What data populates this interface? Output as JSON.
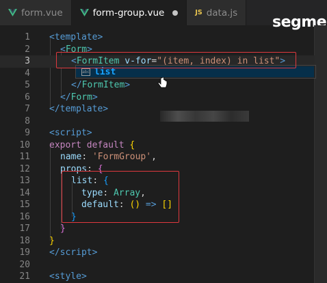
{
  "tabs": [
    {
      "label": "form.vue",
      "icon": "vue-icon"
    },
    {
      "label": "form-group.vue",
      "icon": "vue-icon",
      "active": true,
      "dirty": true
    },
    {
      "label": "data.js",
      "icon": "js-icon",
      "icon_text": "JS"
    }
  ],
  "watermark": "segme",
  "suggestion": {
    "label": "list"
  },
  "lines": [
    {
      "n": "1"
    },
    {
      "n": "2"
    },
    {
      "n": "3"
    },
    {
      "n": "4"
    },
    {
      "n": "5"
    },
    {
      "n": "6"
    },
    {
      "n": "7"
    },
    {
      "n": "8"
    },
    {
      "n": "9"
    },
    {
      "n": "10"
    },
    {
      "n": "11"
    },
    {
      "n": "12"
    },
    {
      "n": "13"
    },
    {
      "n": "14"
    },
    {
      "n": "15"
    },
    {
      "n": "16"
    },
    {
      "n": "17"
    },
    {
      "n": "18"
    },
    {
      "n": "19"
    },
    {
      "n": "20"
    },
    {
      "n": "21"
    }
  ],
  "code": {
    "l1": {
      "open": "<",
      "tag": "template",
      "close": ">"
    },
    "l2": {
      "open": "<",
      "tag": "Form",
      "close": ">"
    },
    "l3": {
      "open": "<",
      "tag": "FormItem",
      "sp": " ",
      "attr": "v-for",
      "eq": "=",
      "str": "\"(item, index) in list\"",
      "close": ">"
    },
    "l4": {
      "text": "",
      "tag": "list"
    },
    "l5": {
      "open": "</",
      "tag": "FormItem",
      "close": ">"
    },
    "l6": {
      "open": "</",
      "tag": "Form",
      "close": ">"
    },
    "l7": {
      "open": "</",
      "tag": "template",
      "close": ">"
    },
    "l9": {
      "open": "<",
      "tag": "script",
      "close": ">"
    },
    "l10": {
      "kw1": "export",
      "kw2": "default",
      "brace": "{"
    },
    "l11": {
      "key": "name",
      "colon": ": ",
      "str": "'FormGroup'",
      "comma": ","
    },
    "l12": {
      "key": "props",
      "colon": ": ",
      "brace": "{"
    },
    "l13": {
      "key": "list",
      "colon": ": ",
      "brace": "{"
    },
    "l14": {
      "key": "type",
      "colon": ": ",
      "ty": "Array",
      "comma": ","
    },
    "l15": {
      "key": "default",
      "colon": ": ",
      "paren": "()",
      "arrow": " => ",
      "arr": "[]"
    },
    "l16": {
      "brace": "}"
    },
    "l17": {
      "brace": "}"
    },
    "l18": {
      "brace": "}"
    },
    "l19": {
      "open": "</",
      "tag": "script",
      "close": ">"
    },
    "l21": {
      "open": "<",
      "tag": "style",
      "close": ">"
    }
  },
  "colors": {
    "background": "#1e1e1e",
    "highlight_box": "#e0393e",
    "suggest_accent": "#18a3ff"
  }
}
